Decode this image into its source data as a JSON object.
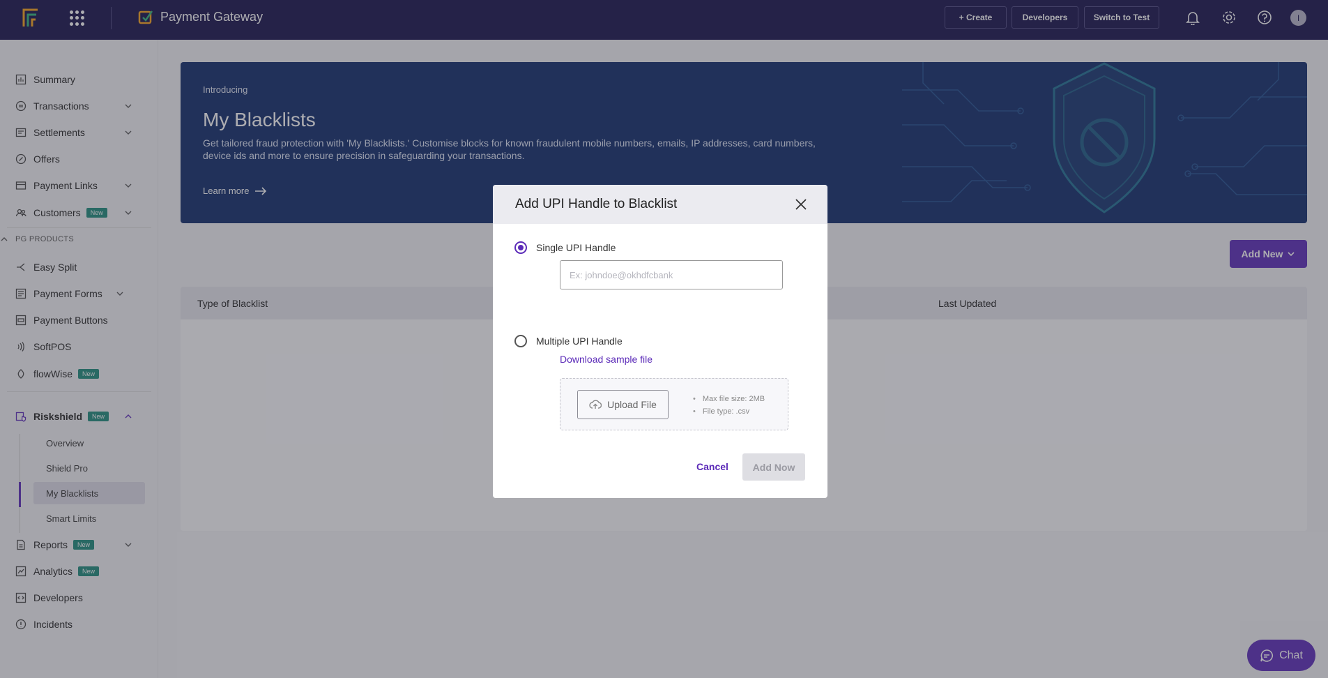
{
  "topbar": {
    "brand": "Payment Gateway",
    "create_label": "+ Create",
    "developers_label": "Developers",
    "switch_label": "Switch to Test",
    "avatar_initial": "I"
  },
  "sidebar": {
    "items": [
      {
        "label": "Summary",
        "icon": "summary-icon"
      },
      {
        "label": "Transactions",
        "icon": "transactions-icon"
      },
      {
        "label": "Settlements",
        "icon": "settlements-icon"
      },
      {
        "label": "Offers",
        "icon": "offers-icon"
      },
      {
        "label": "Payment Links",
        "icon": "link-icon"
      },
      {
        "label": "Customers",
        "icon": "customers-icon",
        "badge": "New"
      }
    ],
    "section_label": "PG PRODUCTS",
    "pg_items": [
      {
        "label": "Easy Split"
      },
      {
        "label": "Payment Forms"
      },
      {
        "label": "Payment Buttons"
      },
      {
        "label": "SoftPOS"
      },
      {
        "label": "flowWise",
        "badge": "New"
      },
      {
        "label": "Riskshield",
        "badge": "New"
      }
    ],
    "riskshield_sub": [
      "Overview",
      "Shield Pro",
      "My Blacklists",
      "Smart Limits"
    ],
    "bottom_items": [
      {
        "label": "Reports",
        "badge": "New"
      },
      {
        "label": "Analytics",
        "badge": "New"
      },
      {
        "label": "Developers"
      },
      {
        "label": "Incidents"
      }
    ]
  },
  "banner": {
    "intro": "Introducing",
    "title": "My Blacklists",
    "description": "Get tailored fraud protection with 'My Blacklists.' Customise blocks for known fraudulent mobile numbers, emails, IP addresses, card numbers, device ids and more to ensure precision in safeguarding your transactions.",
    "learn_more": "Learn more"
  },
  "main": {
    "add_new_label": "Add New",
    "table_headers": [
      "Type of Blacklist",
      "Last Updated"
    ]
  },
  "modal": {
    "title": "Add UPI Handle to Blacklist",
    "option_single": "Single UPI Handle",
    "input_placeholder": "Ex: johndoe@okhdfcbank",
    "option_multiple": "Multiple UPI Handle",
    "download_link": "Download sample file",
    "upload_label": "Upload File",
    "hint_size": "Max file size: 2MB",
    "hint_type": "File type: .csv",
    "cancel_label": "Cancel",
    "add_now_label": "Add Now"
  },
  "chat_label": "Chat",
  "colors": {
    "topbar": "#15104a",
    "accent": "#5b2ab8",
    "banner": "#0f2a6a",
    "badge": "#1d8a7a"
  }
}
